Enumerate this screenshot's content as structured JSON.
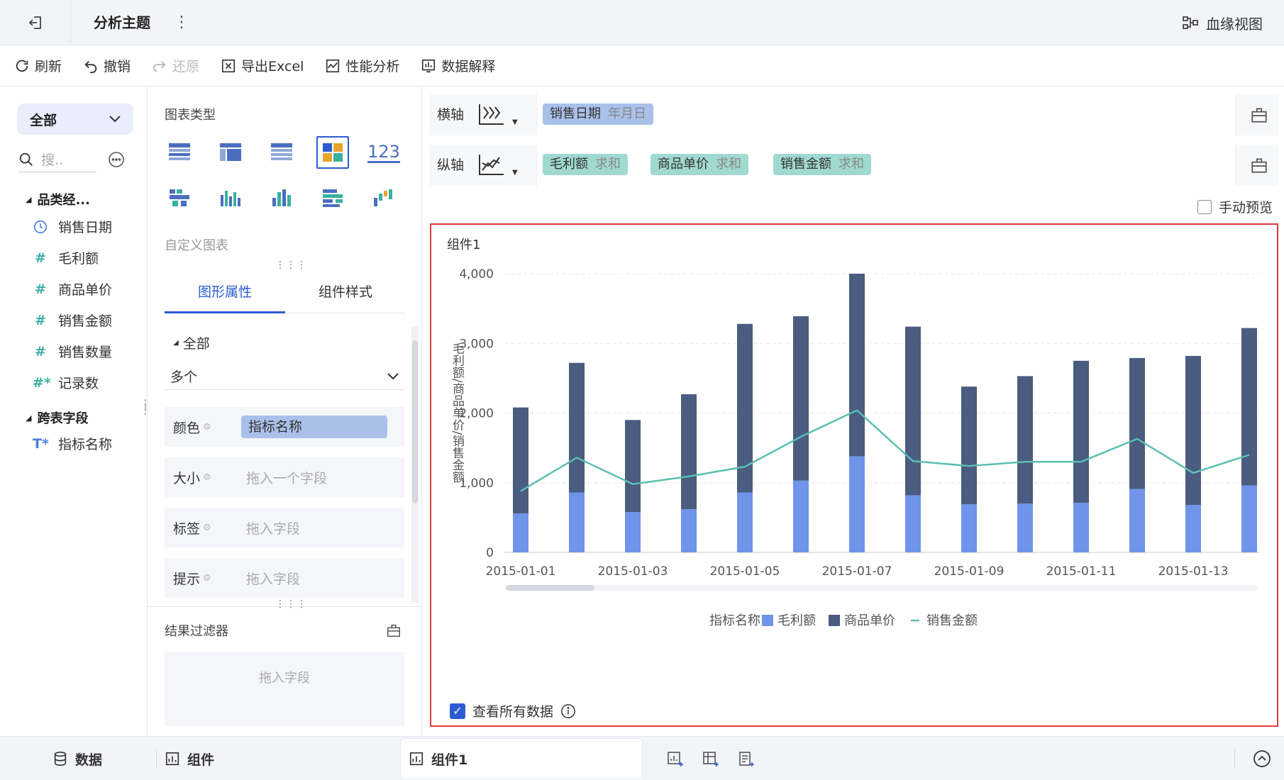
{
  "topbar": {
    "title": "分析主题",
    "more": "⋮",
    "lineage_label": "血缘视图"
  },
  "toolbar": {
    "refresh": "刷新",
    "undo": "撤销",
    "redo": "还原",
    "export_excel": "导出Excel",
    "performance": "性能分析",
    "explain": "数据解释"
  },
  "left": {
    "scope": "全部",
    "search_placeholder": "搜..",
    "group1": "品类经...",
    "fields": [
      {
        "type": "date",
        "label": "销售日期"
      },
      {
        "type": "#",
        "label": "毛利额"
      },
      {
        "type": "#",
        "label": "商品单价"
      },
      {
        "type": "#",
        "label": "销售金额"
      },
      {
        "type": "#",
        "label": "销售数量"
      },
      {
        "type": "#*",
        "label": "记录数"
      }
    ],
    "group2": "跨表字段",
    "cross_field": {
      "type": "T*",
      "label": "指标名称"
    }
  },
  "middle": {
    "chart_type_title": "图表类型",
    "custom_chart": "自定义图表",
    "tab_props": "图形属性",
    "tab_style": "组件样式",
    "all_label": "全部",
    "multi_label": "多个",
    "color_label": "颜色",
    "color_value": "指标名称",
    "size_label": "大小",
    "size_placeholder": "拖入一个字段",
    "label_label": "标签",
    "label_placeholder": "拖入字段",
    "tip_label": "提示",
    "tip_placeholder": "拖入字段",
    "filter_title": "结果过滤器",
    "filter_placeholder": "拖入字段",
    "icon_123": "123"
  },
  "axes": {
    "x_label": "横轴",
    "y_label": "纵轴",
    "x_field": {
      "name": "销售日期",
      "agg": "年月日"
    },
    "y_fields": [
      {
        "name": "毛利额",
        "agg": "求和"
      },
      {
        "name": "商品单价",
        "agg": "求和"
      },
      {
        "name": "销售金额",
        "agg": "求和"
      }
    ]
  },
  "manual_preview": "手动预览",
  "view_all": "查看所有数据",
  "bottom": {
    "data_tab": "数据",
    "component_tab": "组件",
    "active_tab": "组件1"
  },
  "colors": {
    "light_bar": "#6f94ea",
    "dark_bar": "#4a5c80",
    "line": "#5bbfb0",
    "accent": "#2d5bd1",
    "highlight": "#e03a3a"
  },
  "chart_data": {
    "type": "bar",
    "title": "组件1",
    "ylabel": "毛利额/商品单价/销售金额",
    "ylim": [
      0,
      4000
    ],
    "yticks": [
      "0",
      "1,000",
      "2,000",
      "3,000",
      "4,000"
    ],
    "x_tick_labels": [
      "2015-01-01",
      "2015-01-03",
      "2015-01-05",
      "2015-01-07",
      "2015-01-09",
      "2015-01-11",
      "2015-01-13"
    ],
    "categories": [
      "2015-01-01",
      "2015-01-02",
      "2015-01-03",
      "2015-01-04",
      "2015-01-05",
      "2015-01-06",
      "2015-01-07",
      "2015-01-08",
      "2015-01-09",
      "2015-01-10",
      "2015-01-11",
      "2015-01-12",
      "2015-01-13",
      "2015-01-14"
    ],
    "legend_title": "指标名称",
    "series": [
      {
        "name": "毛利额",
        "kind": "stacked-bar",
        "values": [
          560,
          860,
          580,
          620,
          860,
          1030,
          1380,
          820,
          690,
          700,
          710,
          910,
          680,
          960
        ]
      },
      {
        "name": "商品单价",
        "kind": "stacked-bar",
        "values": [
          1520,
          1860,
          1320,
          1650,
          2420,
          2360,
          2620,
          2420,
          1690,
          1830,
          2040,
          1880,
          2140,
          2260
        ]
      },
      {
        "name": "销售金额",
        "kind": "line",
        "values": [
          880,
          1360,
          980,
          1090,
          1230,
          1660,
          2040,
          1310,
          1240,
          1300,
          1300,
          1630,
          1140,
          1400
        ]
      }
    ],
    "grid": true,
    "legend_position": "bottom"
  }
}
